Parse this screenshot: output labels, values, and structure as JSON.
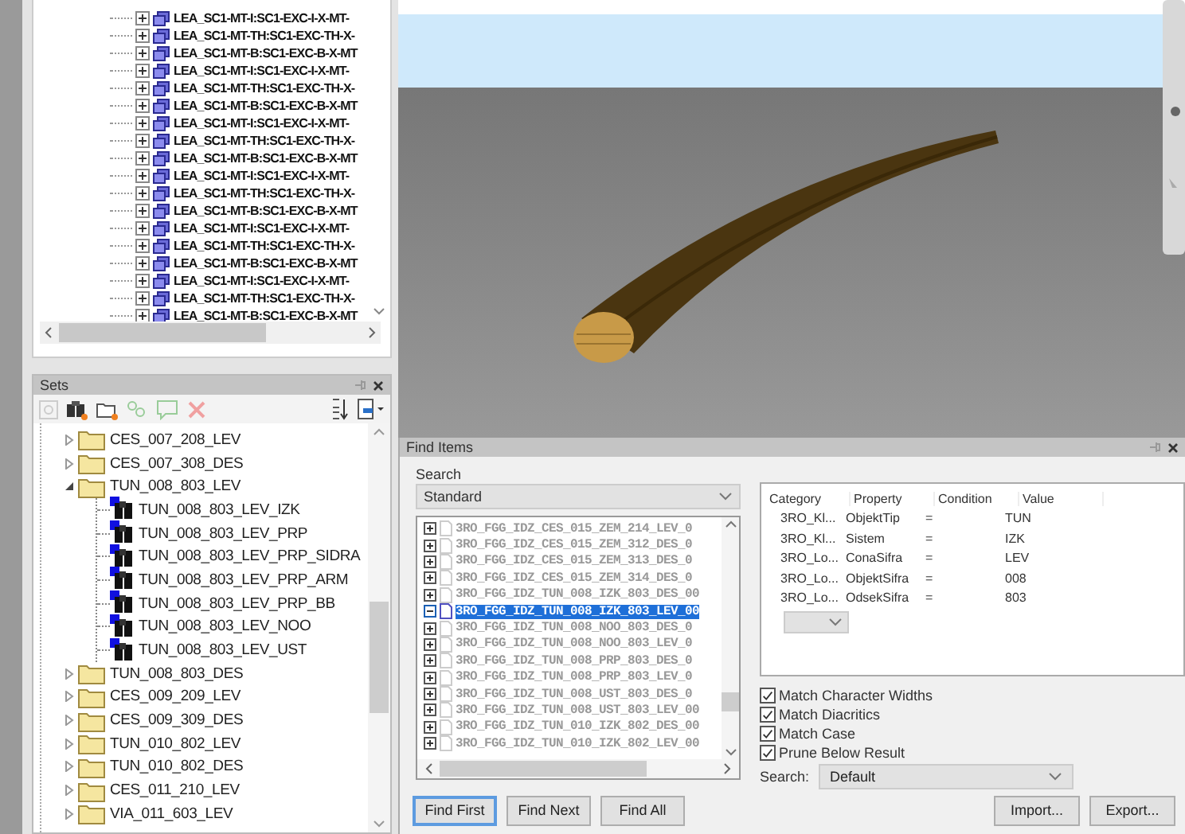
{
  "model_tree": {
    "items": [
      {
        "label": "LEA_SC1-MT-I:SC1-EXC-I-X-MT-",
        "expanded": false
      },
      {
        "label": "LEA_SC1-MT-TH:SC1-EXC-TH-X-",
        "expanded": false
      },
      {
        "label": "LEA_SC1-MT-B:SC1-EXC-B-X-MT",
        "expanded": false
      },
      {
        "label": "LEA_SC1-MT-I:SC1-EXC-I-X-MT-",
        "expanded": false
      },
      {
        "label": "LEA_SC1-MT-TH:SC1-EXC-TH-X-",
        "expanded": false
      },
      {
        "label": "LEA_SC1-MT-B:SC1-EXC-B-X-MT",
        "expanded": false
      },
      {
        "label": "LEA_SC1-MT-I:SC1-EXC-I-X-MT-",
        "expanded": false
      },
      {
        "label": "LEA_SC1-MT-TH:SC1-EXC-TH-X-",
        "expanded": false
      },
      {
        "label": "LEA_SC1-MT-B:SC1-EXC-B-X-MT",
        "expanded": false
      },
      {
        "label": "LEA_SC1-MT-I:SC1-EXC-I-X-MT-",
        "expanded": false
      },
      {
        "label": "LEA_SC1-MT-TH:SC1-EXC-TH-X-",
        "expanded": false
      },
      {
        "label": "LEA_SC1-MT-B:SC1-EXC-B-X-MT",
        "expanded": false
      },
      {
        "label": "LEA_SC1-MT-I:SC1-EXC-I-X-MT-",
        "expanded": false
      },
      {
        "label": "LEA_SC1-MT-TH:SC1-EXC-TH-X-",
        "expanded": false
      },
      {
        "label": "LEA_SC1-MT-B:SC1-EXC-B-X-MT",
        "expanded": false
      },
      {
        "label": "LEA_SC1-MT-I:SC1-EXC-I-X-MT-",
        "expanded": false
      },
      {
        "label": "LEA_SC1-MT-TH:SC1-EXC-TH-X-",
        "expanded": false
      },
      {
        "label": "LEA_SC1-MT-B:SC1-EXC-B-X-MT",
        "expanded": false
      }
    ]
  },
  "sets": {
    "title": "Sets",
    "items": [
      {
        "kind": "folder",
        "label": "CES_007_208_LEV",
        "expanded": false
      },
      {
        "kind": "folder",
        "label": "CES_007_308_DES",
        "expanded": false
      },
      {
        "kind": "folder",
        "label": "TUN_008_803_LEV",
        "expanded": true,
        "children": [
          {
            "kind": "search_set",
            "label": "TUN_008_803_LEV_IZK"
          },
          {
            "kind": "search_set",
            "label": "TUN_008_803_LEV_PRP"
          },
          {
            "kind": "search_set",
            "label": "TUN_008_803_LEV_PRP_SIDRA"
          },
          {
            "kind": "search_set",
            "label": "TUN_008_803_LEV_PRP_ARM"
          },
          {
            "kind": "search_set",
            "label": "TUN_008_803_LEV_PRP_BB"
          },
          {
            "kind": "search_set",
            "label": "TUN_008_803_LEV_NOO"
          },
          {
            "kind": "search_set",
            "label": "TUN_008_803_LEV_UST"
          }
        ]
      },
      {
        "kind": "folder",
        "label": "TUN_008_803_DES",
        "expanded": false
      },
      {
        "kind": "folder",
        "label": "CES_009_209_LEV",
        "expanded": false
      },
      {
        "kind": "folder",
        "label": "CES_009_309_DES",
        "expanded": false
      },
      {
        "kind": "folder",
        "label": "TUN_010_802_LEV",
        "expanded": false
      },
      {
        "kind": "folder",
        "label": "TUN_010_802_DES",
        "expanded": false
      },
      {
        "kind": "folder",
        "label": "CES_011_210_LEV",
        "expanded": false
      },
      {
        "kind": "folder",
        "label": "VIA_011_603_LEV",
        "expanded": false
      }
    ]
  },
  "find_items": {
    "title": "Find Items",
    "search_label": "Search",
    "search_mode": "Standard",
    "results": [
      {
        "label": "3RO_FGG_IDZ_CES_015_ZEM_214_LEV_0",
        "selected": false
      },
      {
        "label": "3RO_FGG_IDZ_CES_015_ZEM_312_DES_0",
        "selected": false
      },
      {
        "label": "3RO_FGG_IDZ_CES_015_ZEM_313_DES_0",
        "selected": false
      },
      {
        "label": "3RO_FGG_IDZ_CES_015_ZEM_314_DES_0",
        "selected": false
      },
      {
        "label": "3RO_FGG_IDZ_TUN_008_IZK_803_DES_00",
        "selected": false
      },
      {
        "label": "3RO_FGG_IDZ_TUN_008_IZK_803_LEV_00",
        "selected": true
      },
      {
        "label": "3RO_FGG_IDZ_TUN_008_NOO_803_DES_0",
        "selected": false
      },
      {
        "label": "3RO_FGG_IDZ_TUN_008_NOO_803_LEV_0",
        "selected": false
      },
      {
        "label": "3RO_FGG_IDZ_TUN_008_PRP_803_DES_0",
        "selected": false
      },
      {
        "label": "3RO_FGG_IDZ_TUN_008_PRP_803_LEV_0",
        "selected": false
      },
      {
        "label": "3RO_FGG_IDZ_TUN_008_UST_803_DES_0",
        "selected": false
      },
      {
        "label": "3RO_FGG_IDZ_TUN_008_UST_803_LEV_00",
        "selected": false
      },
      {
        "label": "3RO_FGG_IDZ_TUN_010_IZK_802_DES_00",
        "selected": false
      },
      {
        "label": "3RO_FGG_IDZ_TUN_010_IZK_802_LEV_00",
        "selected": false
      }
    ],
    "conditions": {
      "columns": [
        "Category",
        "Property",
        "Condition",
        "Value"
      ],
      "rows": [
        [
          "3RO_Kl...",
          "ObjektTip",
          "=",
          "TUN"
        ],
        [
          "3RO_Kl...",
          "Sistem",
          "=",
          "IZK"
        ],
        [
          "3RO_Lo...",
          "ConaSifra",
          "=",
          "LEV"
        ],
        [
          "3RO_Lo...",
          "ObjektSifra",
          "=",
          "008"
        ],
        [
          "3RO_Lo...",
          "OdsekSifra",
          "=",
          "803"
        ]
      ]
    },
    "options": [
      {
        "label": "Match Character Widths",
        "checked": true
      },
      {
        "label": "Match Diacritics",
        "checked": true
      },
      {
        "label": "Match Case",
        "checked": true
      },
      {
        "label": "Prune Below Result",
        "checked": true
      }
    ],
    "search_scope": {
      "label": "Search:",
      "value": "Default"
    },
    "find_buttons": [
      {
        "label": "Find First",
        "focused": true
      },
      {
        "label": "Find Next",
        "focused": false
      },
      {
        "label": "Find All",
        "focused": false
      }
    ],
    "io_buttons": [
      "Import...",
      "Export..."
    ]
  }
}
